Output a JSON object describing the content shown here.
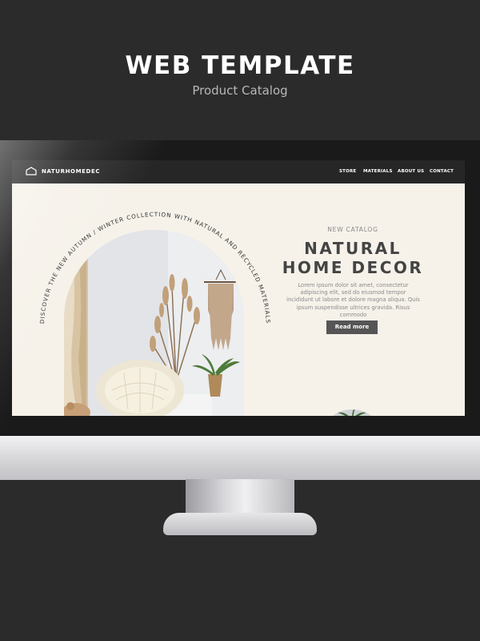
{
  "poster": {
    "title": "WEB TEMPLATE",
    "subtitle": "Product Catalog"
  },
  "site": {
    "brand": "NATURHOMEDEC",
    "nav": [
      "STORE",
      "MATERIALS",
      "ABOUT US",
      "CONTACT"
    ],
    "arc_text": "DISCOVER THE NEW AUTUMN / WINTER COLLECTION WITH NATURAL AND RECYCLED MATERIALS",
    "hero": {
      "label": "NEW CATALOG",
      "title_line1": "NATURAL",
      "title_line2": "HOME DECOR",
      "body": "Lorem ipsum dolor sit amet, consectetur adipiscing elit, sed do eiusmod tempor incididunt ut labore et dolore magna aliqua. Quis ipsum suspendisse ultrices gravida. Risus commodo",
      "button": "Read more"
    }
  },
  "colors": {
    "background": "#2b2b2b",
    "screen_bg": "#f6f2ea",
    "nav_bg": "#262626",
    "title_text": "#444444",
    "button_bg": "#555555"
  }
}
